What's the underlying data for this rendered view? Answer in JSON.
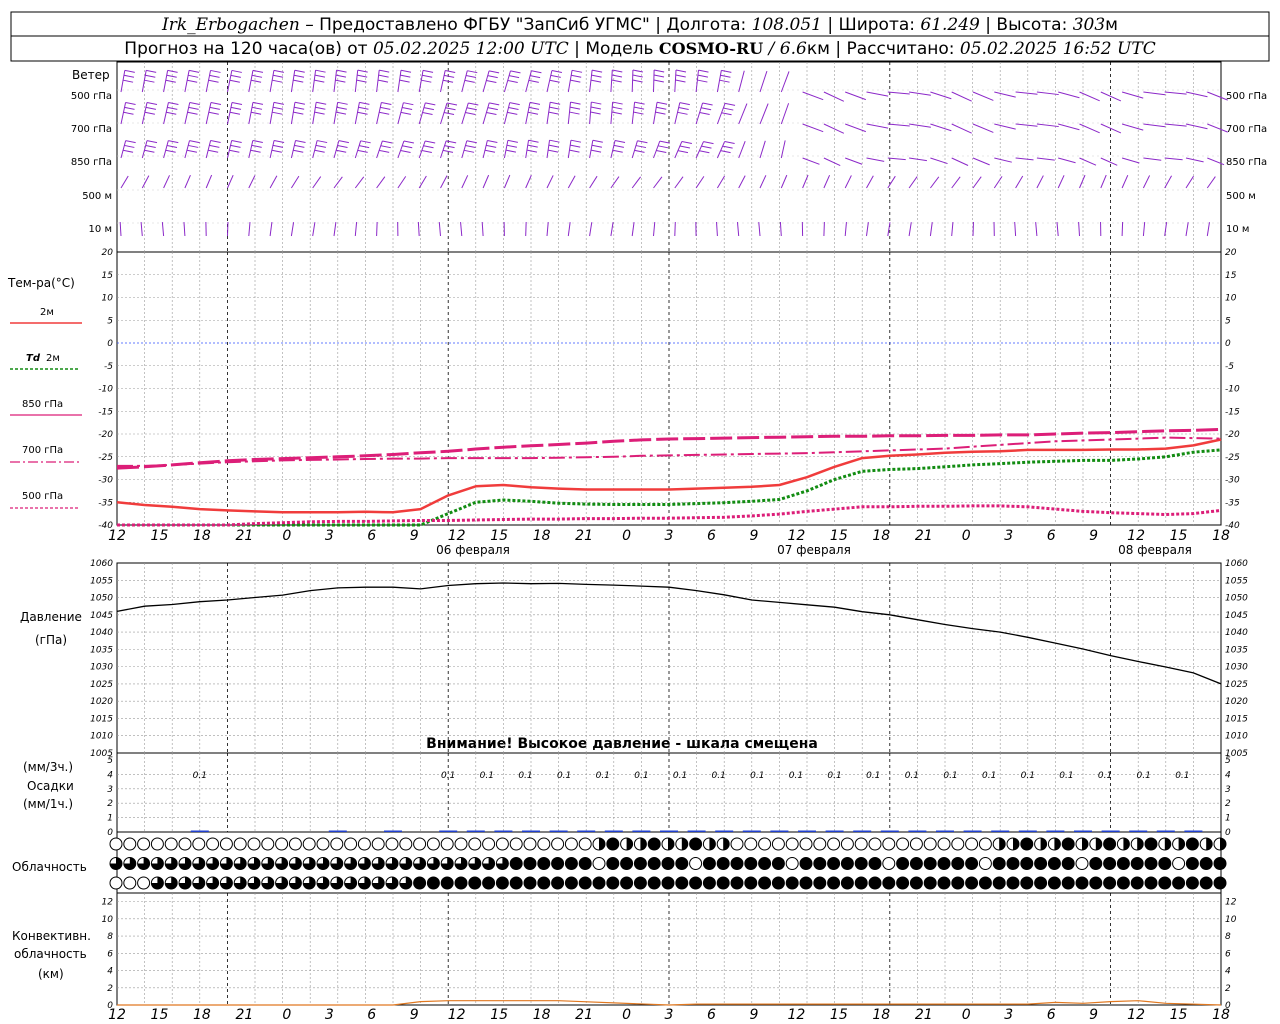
{
  "header": {
    "station": "Irk_Erbogachen",
    "provider": " – Предоставлено ФГБУ \"ЗапСиб УГМС\" | Долгота: ",
    "lon": "108.051",
    "lat_label": " | Широта: ",
    "lat": "61.249",
    "alt_label": " | Высота: ",
    "alt": "303",
    "alt_unit": "м",
    "forecast_label": "Прогноз на 120 часа(ов) от ",
    "forecast_from": "05.02.2025 12:00 UTC",
    "model_label": "  | Модель ",
    "model": "COSMO-RU",
    "model_res": " / 6.6",
    "model_res_unit": "км",
    "calc_label": " | Рассчитано: ",
    "calc_time": "05.02.2025 16:52 UTC"
  },
  "x_hour_labels": [
    "12",
    "15",
    "18",
    "21",
    "0",
    "3",
    "6",
    "9",
    "12",
    "15",
    "18",
    "21",
    "0",
    "3",
    "6",
    "9",
    "12",
    "15",
    "18",
    "21",
    "0",
    "3",
    "6",
    "9",
    "12",
    "15",
    "18"
  ],
  "day_labels": [
    "06 февраля",
    "07 февраля",
    "08 февраля"
  ],
  "wind_panel": {
    "title": "Ветер",
    "levels": [
      "500 гПа",
      "700 гПа",
      "850 гПа",
      "500 м",
      "10 м"
    ]
  },
  "temp_panel": {
    "title": "Тем-ра(°C)",
    "ticks": [
      "20",
      "15",
      "10",
      "5",
      "0",
      "-5",
      "-10",
      "-15",
      "-20",
      "-25",
      "-30",
      "-35",
      "-40"
    ],
    "legend": [
      {
        "label": "2м",
        "color": "#f03c3c"
      },
      {
        "label_i": "Td",
        "label": "2м",
        "color": "#128c12"
      },
      {
        "label": "850 гПа",
        "color": "#dc1e78"
      },
      {
        "label": "700 гПа",
        "color": "#dc1e78"
      },
      {
        "label": "500 гПа",
        "color": "#dc1e78"
      }
    ]
  },
  "pressure_panel": {
    "title1": "Давление",
    "title2": "(гПа)",
    "ticks": [
      "1060",
      "1055",
      "1050",
      "1045",
      "1040",
      "1035",
      "1030",
      "1025",
      "1020",
      "1015",
      "1010",
      "1005"
    ],
    "warning": "Внимание! Высокое давление - шкала смещена"
  },
  "precip_panel": {
    "title1": "(мм/3ч.)",
    "title2": "Осадки",
    "title3": "(мм/1ч.)",
    "ticks": [
      "5",
      "4",
      "3",
      "2",
      "1",
      "0"
    ],
    "labels": [
      "0.1",
      "0.1",
      "0.1",
      "0.1",
      "0.1",
      "0.1",
      "0.1",
      "0.1",
      "0.1",
      "0.1",
      "0.1",
      "0.1",
      "0.1",
      "0.1",
      "0.1",
      "0.1",
      "0.1",
      "0.1",
      "0.1",
      "0.1",
      "0.1"
    ]
  },
  "cloud_panel": {
    "title": "Облачность"
  },
  "conv_panel": {
    "title1": "Конвективн.",
    "title2": "облачность",
    "title3": "(км)",
    "ticks": [
      "12",
      "10",
      "8",
      "6",
      "4",
      "2",
      "0"
    ]
  },
  "chart_data": [
    {
      "type": "line",
      "name": "temperature",
      "ylim": [
        -40,
        20
      ],
      "x_hours": [
        0,
        3,
        6,
        9,
        12,
        15,
        18,
        21,
        24,
        27,
        30,
        33,
        36,
        39,
        42,
        45,
        48,
        51,
        54,
        57,
        60,
        63,
        66,
        69,
        72,
        75,
        78,
        81,
        84,
        87,
        90,
        93,
        96,
        99,
        102,
        105,
        108,
        111,
        114,
        117,
        120
      ],
      "series": [
        {
          "name": "2м",
          "color": "#f03c3c",
          "values": [
            -35,
            -35.6,
            -36,
            -36.5,
            -36.8,
            -37,
            -37.2,
            -37.2,
            -37.2,
            -37.1,
            -37.2,
            -36.5,
            -33.5,
            -31.5,
            -31.2,
            -31.7,
            -32,
            -32.2,
            -32.2,
            -32.2,
            -32.2,
            -32,
            -31.8,
            -31.6,
            -31.2,
            -29.5,
            -27.2,
            -25.3,
            -24.8,
            -24.5,
            -24.1,
            -23.9,
            -23.8,
            -23.5,
            -23.5,
            -23.5,
            -23.4,
            -23.4,
            -23.2,
            -22.5,
            -21.2
          ]
        },
        {
          "name": "Td 2м",
          "color": "#128c12",
          "values": [
            -40,
            -40.5,
            -41,
            -41.5,
            -42,
            -42,
            -42,
            -42,
            -42,
            -42,
            -42,
            -40.5,
            -37.5,
            -35,
            -34.5,
            -34.8,
            -35.2,
            -35.4,
            -35.5,
            -35.5,
            -35.5,
            -35.3,
            -35.1,
            -34.8,
            -34.4,
            -32.5,
            -30,
            -28.2,
            -27.8,
            -27.6,
            -27.2,
            -26.8,
            -26.5,
            -26.2,
            -26,
            -25.8,
            -25.8,
            -25.5,
            -25,
            -24,
            -23.5
          ]
        },
        {
          "name": "850 гПа",
          "color": "#dc1e78",
          "values": [
            -27.5,
            -27.2,
            -26.8,
            -26.3,
            -25.9,
            -25.6,
            -25.4,
            -25.2,
            -25,
            -24.8,
            -24.5,
            -24.1,
            -23.8,
            -23.3,
            -22.9,
            -22.6,
            -22.3,
            -22,
            -21.6,
            -21.3,
            -21.1,
            -21,
            -20.9,
            -20.8,
            -20.7,
            -20.6,
            -20.5,
            -20.5,
            -20.4,
            -20.4,
            -20.3,
            -20.3,
            -20.2,
            -20.2,
            -20,
            -19.8,
            -19.7,
            -19.5,
            -19.3,
            -19.2,
            -19
          ]
        },
        {
          "name": "700 гПа",
          "color": "#dc1e78",
          "values": [
            -27,
            -27,
            -26.8,
            -26.5,
            -26.2,
            -26,
            -25.8,
            -25.7,
            -25.6,
            -25.5,
            -25.4,
            -25.4,
            -25.3,
            -25.3,
            -25.3,
            -25.3,
            -25.2,
            -25.1,
            -25,
            -24.8,
            -24.7,
            -24.6,
            -24.5,
            -24.4,
            -24.3,
            -24.2,
            -24,
            -23.8,
            -23.6,
            -23.4,
            -23.2,
            -22.8,
            -22.4,
            -22,
            -21.6,
            -21.4,
            -21.2,
            -21,
            -20.8,
            -20.9,
            -21
          ]
        },
        {
          "name": "500 гПа",
          "color": "#dc1e78",
          "values": [
            -41,
            -40.8,
            -40.5,
            -40.3,
            -40,
            -39.7,
            -39.5,
            -39.3,
            -39.2,
            -39.2,
            -39.1,
            -39,
            -39,
            -38.9,
            -38.8,
            -38.7,
            -38.7,
            -38.6,
            -38.6,
            -38.5,
            -38.5,
            -38.4,
            -38.3,
            -38,
            -37.6,
            -37,
            -36.5,
            -36,
            -36,
            -35.9,
            -35.9,
            -35.8,
            -35.8,
            -36,
            -36.5,
            -37,
            -37.3,
            -37.5,
            -37.7,
            -37.5,
            -36.8
          ]
        }
      ]
    },
    {
      "type": "line",
      "name": "pressure",
      "ylim": [
        1005,
        1060
      ],
      "x_hours": [
        0,
        3,
        6,
        9,
        12,
        15,
        18,
        21,
        24,
        27,
        30,
        33,
        36,
        39,
        42,
        45,
        48,
        51,
        54,
        57,
        60,
        63,
        66,
        69,
        72,
        75,
        78,
        81,
        84,
        87,
        90,
        93,
        96,
        99,
        102,
        105,
        108,
        111,
        114,
        117,
        120
      ],
      "series": [
        {
          "name": "Давление",
          "color": "#000000",
          "values": [
            1046,
            1047.5,
            1048,
            1048.8,
            1049.3,
            1050,
            1050.7,
            1052,
            1052.8,
            1053,
            1053,
            1052.5,
            1053.5,
            1054,
            1054.2,
            1054,
            1054.1,
            1053.8,
            1053.6,
            1053.3,
            1053,
            1052,
            1050.8,
            1049.3,
            1048.6,
            1047.9,
            1047.2,
            1045.9,
            1045,
            1043.6,
            1042.2,
            1041,
            1040,
            1038.5,
            1036.8,
            1035.1,
            1033.2,
            1031.5,
            1029.9,
            1028.2,
            1025
          ]
        }
      ]
    },
    {
      "type": "bar",
      "name": "precipitation",
      "ylim": [
        0,
        5
      ],
      "x_hours": [
        9,
        24,
        30,
        36,
        39,
        42,
        45,
        48,
        51,
        54,
        57,
        60,
        63,
        66,
        69,
        72,
        75,
        78,
        81,
        84,
        87,
        90,
        93,
        96,
        99,
        102,
        105,
        108,
        111,
        114,
        117
      ],
      "values": [
        0.1,
        0.02,
        0.05,
        0.1,
        0.1,
        0.1,
        0.1,
        0.1,
        0.1,
        0.1,
        0.1,
        0.1,
        0.1,
        0.1,
        0.1,
        0.1,
        0.1,
        0.1,
        0.1,
        0.1,
        0.1,
        0.1,
        0.1,
        0.1,
        0.1,
        0.1,
        0.1,
        0.1,
        0.1,
        0.1,
        0.1
      ]
    },
    {
      "type": "area",
      "name": "convective cloud",
      "ylim": [
        0,
        13
      ],
      "x_hours": [
        0,
        30,
        33,
        36,
        42,
        45,
        48,
        60,
        63,
        81,
        99,
        102,
        105,
        108,
        111,
        114,
        120
      ],
      "values": [
        0,
        0,
        0.4,
        0.5,
        0.5,
        0.5,
        0.5,
        0,
        0.1,
        0.1,
        0.1,
        0.3,
        0.2,
        0.4,
        0.5,
        0.2,
        0
      ]
    }
  ]
}
